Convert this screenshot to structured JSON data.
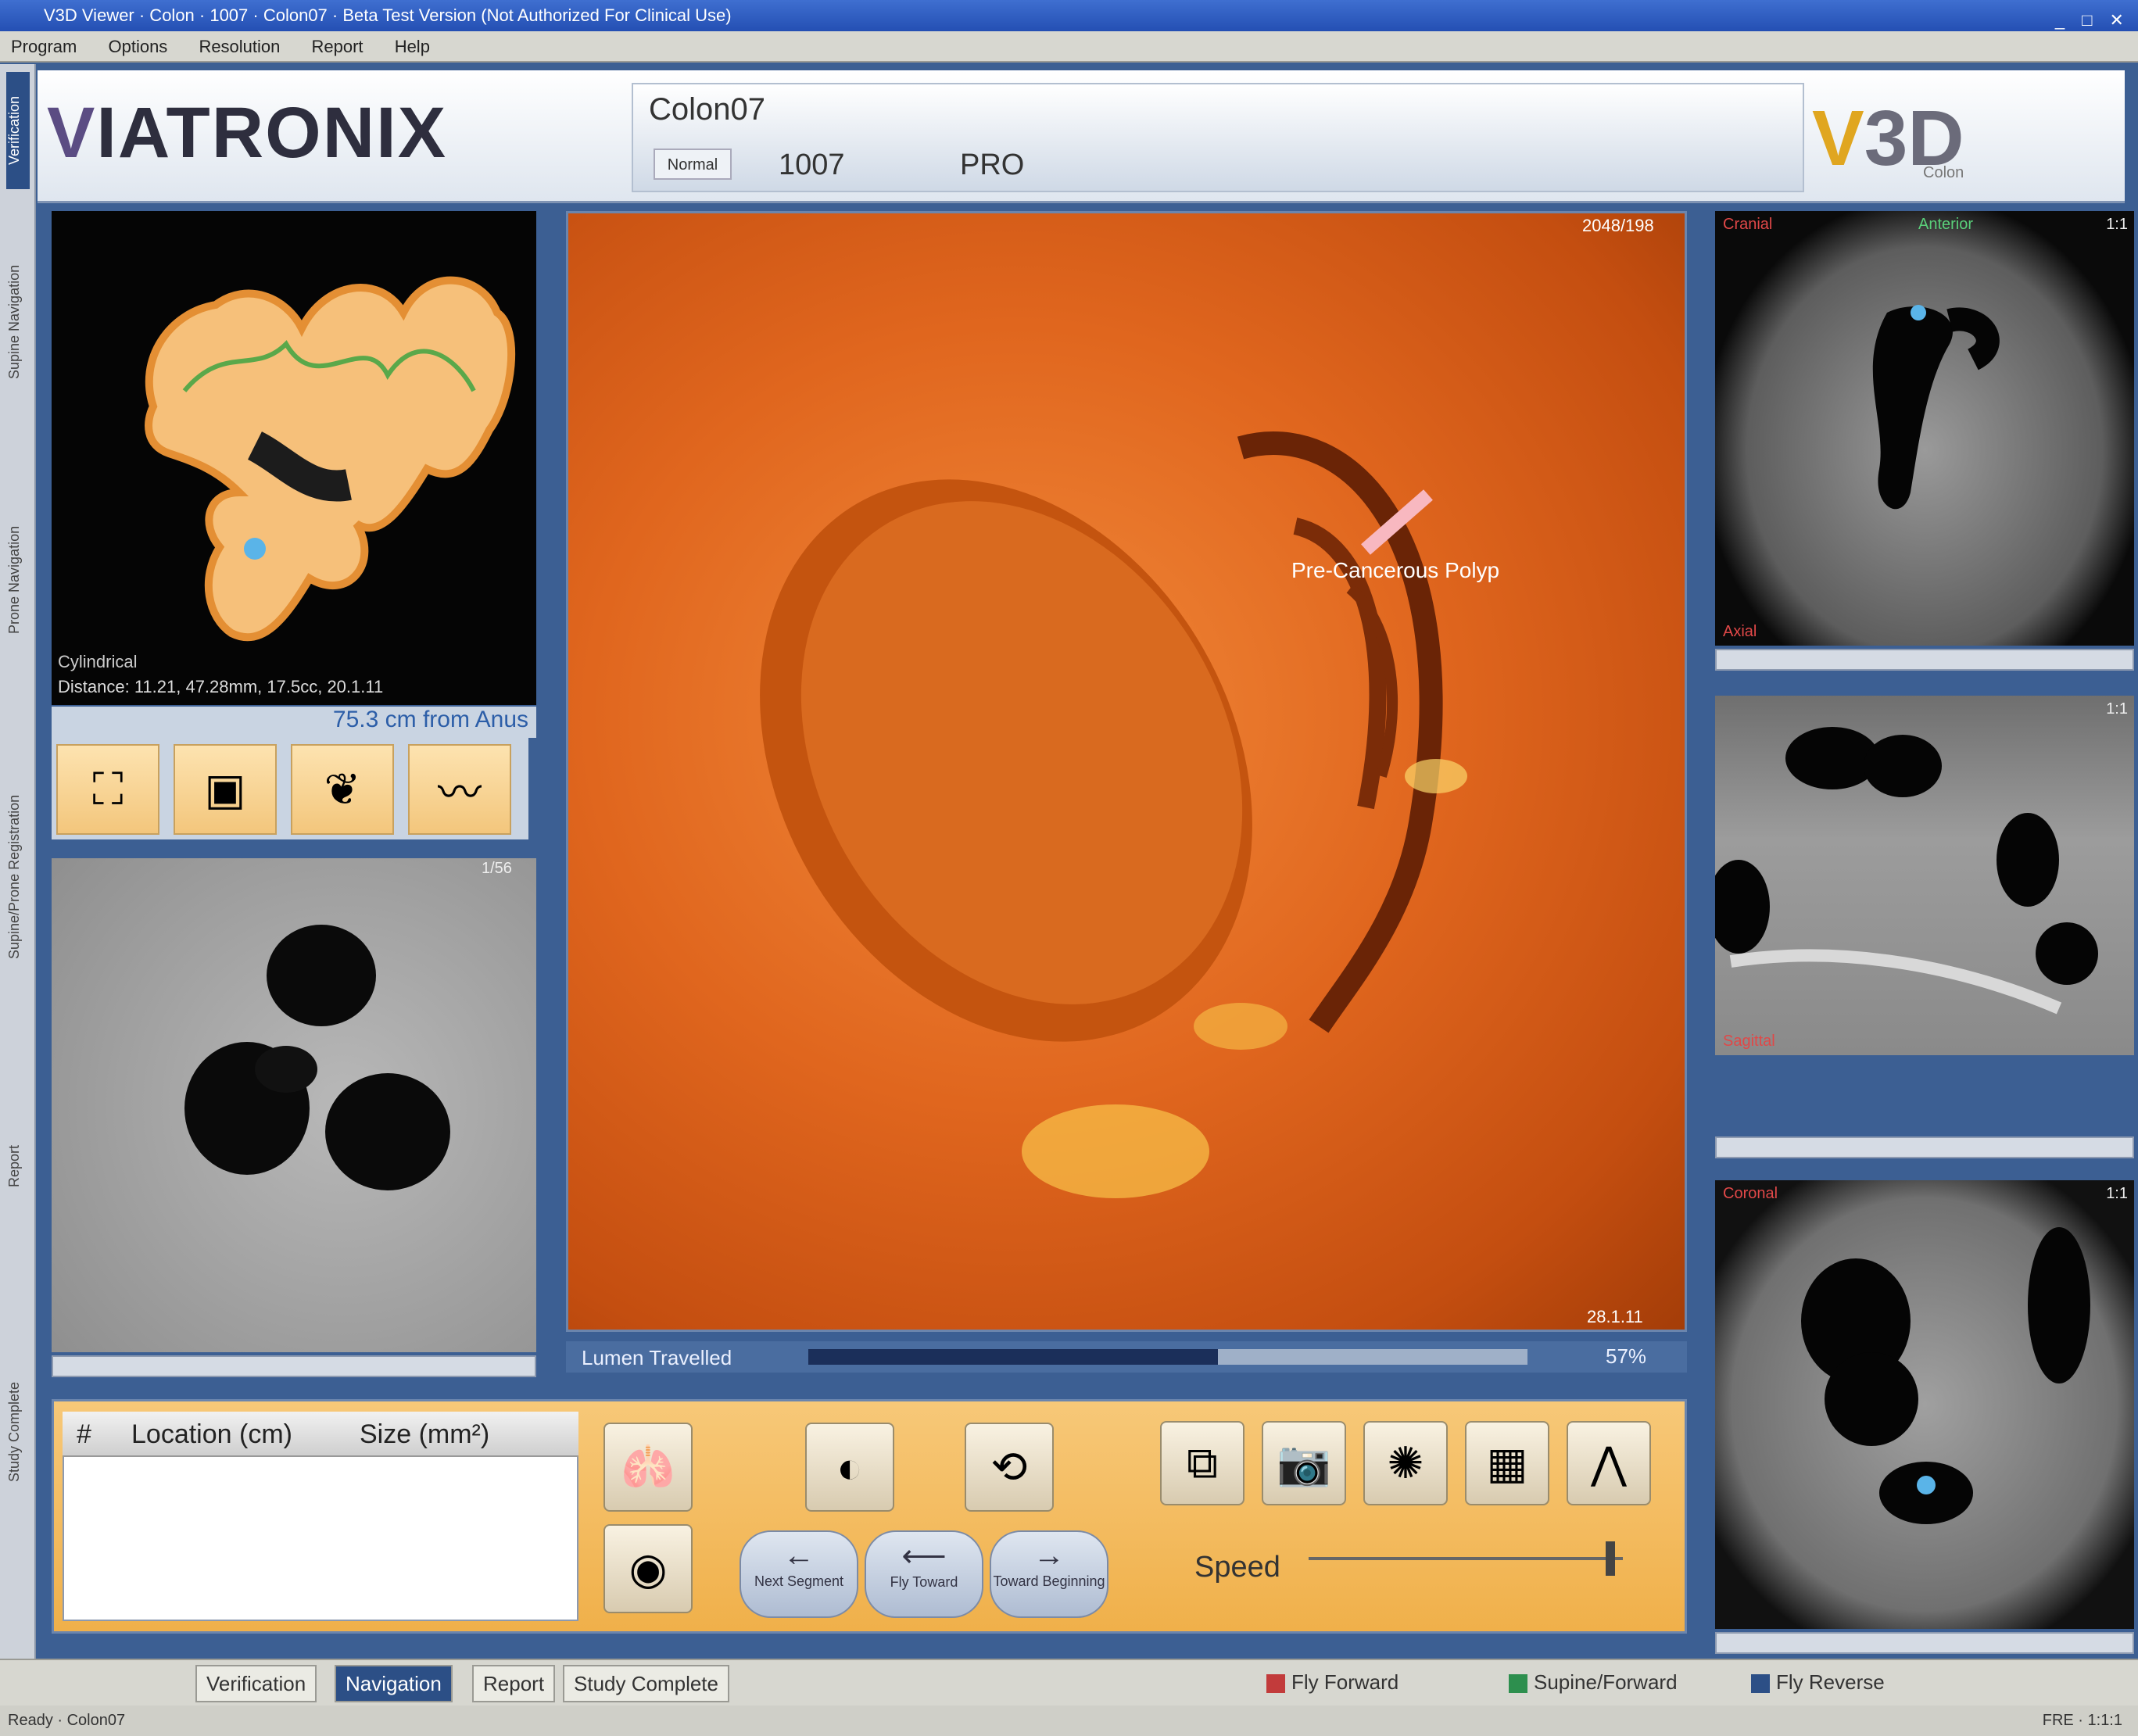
{
  "window": {
    "title": "V3D Viewer · Colon · 1007 · Colon07 · Beta Test Version (Not Authorized For Clinical Use)"
  },
  "menu": [
    "Program",
    "Options",
    "Resolution",
    "Report",
    "Help"
  ],
  "side_tabs": [
    "Verification",
    "Supine Navigation",
    "Prone Navigation",
    "Supine/Prone Registration",
    "Report",
    "Study Complete"
  ],
  "header": {
    "logo_v": "V",
    "logo_rest": "IATRONIX",
    "study_title": "Colon07",
    "tab_normal": "Normal",
    "study_number": "1007",
    "position": "PRO",
    "product_logo_v": "V",
    "product_logo_rest": "3D",
    "product_sub": "Colon"
  },
  "overview": {
    "label_type": "Cylindrical",
    "label_info": "Distance: 11.21, 47.28mm, 17.5cc, 20.1.11",
    "distance": "75.3 cm from Anus"
  },
  "slice_left": {
    "number": "1/56"
  },
  "main_view": {
    "frame_number": "2048/198",
    "coordinates": "28.1.11",
    "cad_label": "Pre-Cancerous Polyp",
    "progress_label": "Lumen Travelled",
    "progress_percent": "57%",
    "progress_fraction": 0.57
  },
  "findings": {
    "columns": [
      "#",
      "Location (cm)",
      "Size (mm²)"
    ],
    "rows": []
  },
  "controls": {
    "icons": [
      "colon-3d-icon",
      "segment-icon",
      "flythrough-icon",
      "snapshot-icon",
      "camera-icon",
      "lens-icon",
      "colormap-icon",
      "landmark-icon",
      "orbit-icon"
    ],
    "nav_buttons": [
      "Next Segment",
      "Fly Toward",
      "Toward Beginning"
    ],
    "speed_label": "Speed",
    "speed_value": 0.96
  },
  "right_slices": {
    "axial": {
      "top_left": "Cranial",
      "top_right": "Anterior",
      "corner": "1:1",
      "bottom_left": "Axial"
    },
    "sagittal": {
      "corner": "1:1",
      "bottom_left": "Sagittal"
    },
    "coronal": {
      "corner": "1:1",
      "top_left": "Coronal"
    }
  },
  "bottom_tabs": [
    "Verification",
    "Navigation",
    "Report",
    "Study Complete"
  ],
  "active_bottom_tab": 1,
  "legend": [
    {
      "label": "Fly Forward",
      "color": "#c23b3b"
    },
    {
      "label": "Supine/Forward",
      "color": "#2d8f4e"
    },
    {
      "label": "Fly Reverse",
      "color": "#2c4f86"
    }
  ],
  "status": {
    "left": "Ready · Colon07",
    "right": "FRE · 1:1:1"
  }
}
